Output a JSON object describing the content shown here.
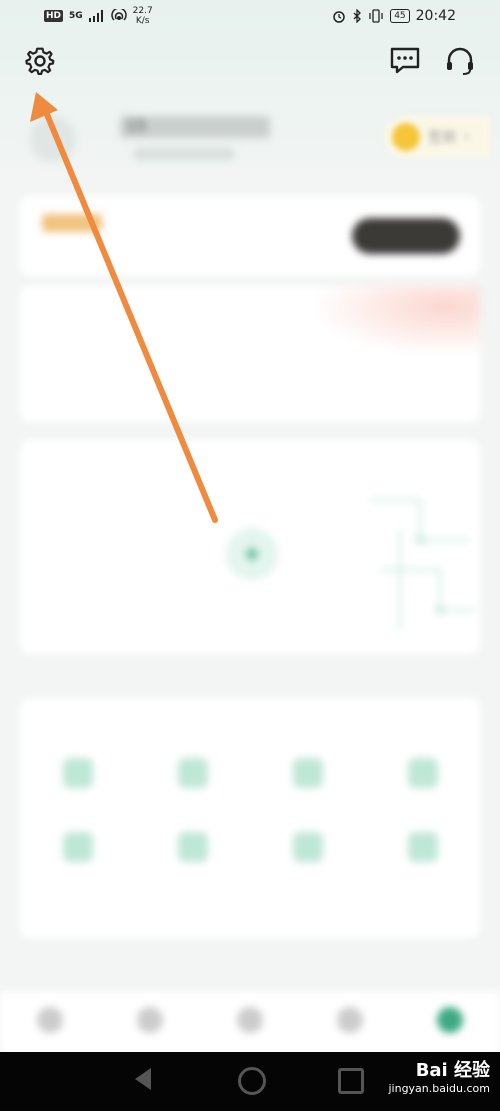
{
  "status_bar": {
    "hd": "HD",
    "net_type": "5G",
    "net_speed_value": "22.7",
    "net_speed_unit": "K/s",
    "battery": "45",
    "time": "20:42"
  },
  "header": {
    "settings_icon": "gear-icon",
    "messages_icon": "message-icon",
    "support_icon": "headset-icon"
  },
  "profile": {
    "name": "15",
    "sign_in_label": "签到"
  },
  "vip_card": {
    "badge": "",
    "title": "",
    "subtitle": "",
    "button": ""
  },
  "stats": {
    "title": "",
    "items": [
      {
        "value": "",
        "label": ""
      },
      {
        "value": "",
        "label": ""
      },
      {
        "value": "",
        "label": ""
      }
    ]
  },
  "devices": {
    "title": "",
    "add_caption": ""
  },
  "services": {
    "title": "",
    "items": [
      {
        "label": ""
      },
      {
        "label": ""
      },
      {
        "label": ""
      },
      {
        "label": ""
      },
      {
        "label": ""
      },
      {
        "label": ""
      },
      {
        "label": ""
      },
      {
        "label": ""
      }
    ]
  },
  "tabbar": {
    "items": [
      {
        "label": ""
      },
      {
        "label": ""
      },
      {
        "label": ""
      },
      {
        "label": ""
      },
      {
        "label": ""
      }
    ],
    "active_index": 4
  },
  "watermark": {
    "logo": "Bai 经验",
    "url": "jingyan.baidu.com"
  },
  "colors": {
    "accent": "#3daa84",
    "annotation_arrow": "#f08a3e",
    "vip_gold": "#f0c37f"
  }
}
